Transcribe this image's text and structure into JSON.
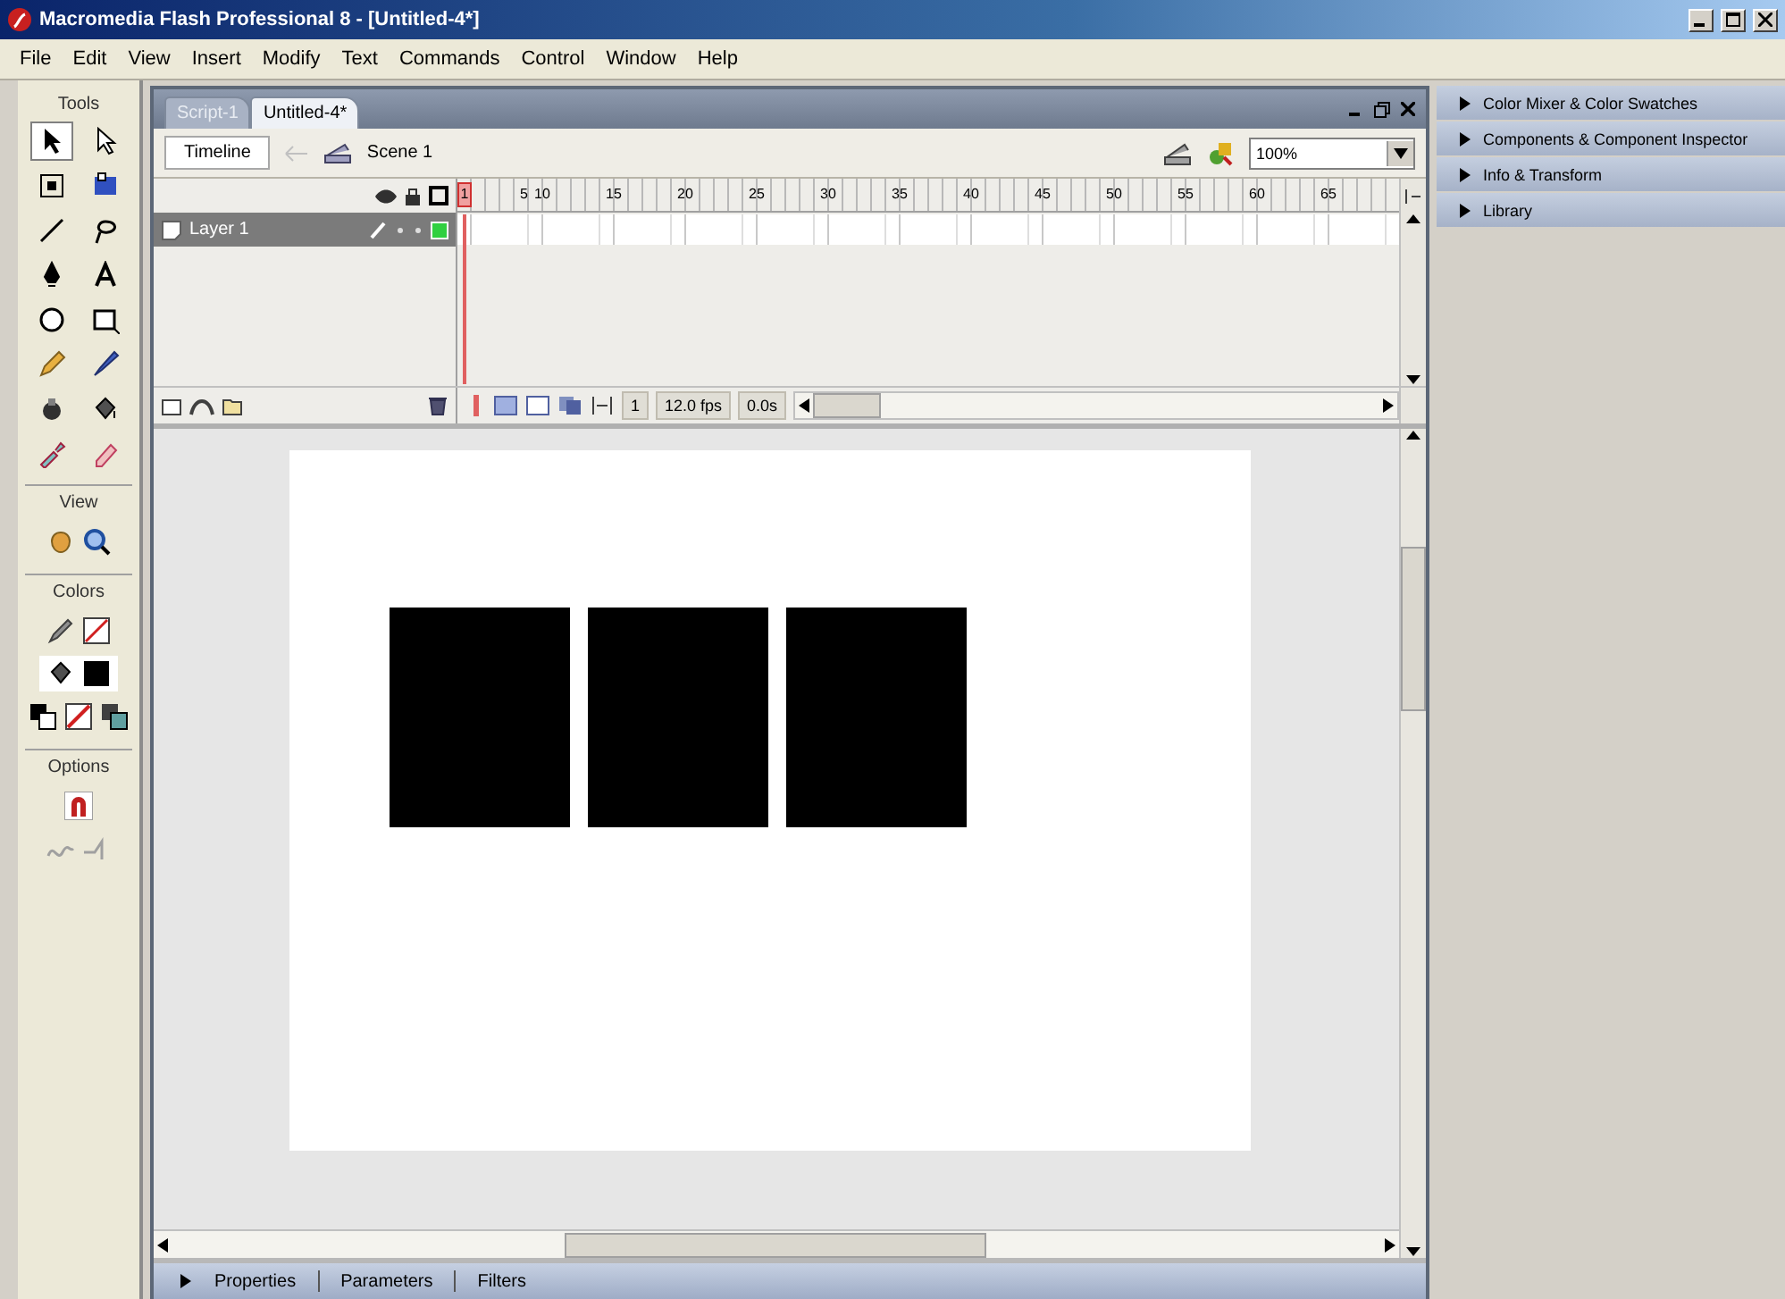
{
  "window": {
    "title": "Macromedia Flash Professional 8 - [Untitled-4*]"
  },
  "menu": [
    "File",
    "Edit",
    "View",
    "Insert",
    "Modify",
    "Text",
    "Commands",
    "Control",
    "Window",
    "Help"
  ],
  "tools": {
    "title": "Tools",
    "items": [
      {
        "kind": "arrow",
        "selected": true
      },
      {
        "kind": "subselect",
        "selected": false
      },
      {
        "kind": "transform",
        "selected": false
      },
      {
        "kind": "gradient",
        "selected": false
      },
      {
        "kind": "line",
        "selected": false
      },
      {
        "kind": "lasso",
        "selected": false
      },
      {
        "kind": "pen",
        "selected": false
      },
      {
        "kind": "text",
        "selected": false
      },
      {
        "kind": "oval",
        "selected": false
      },
      {
        "kind": "rectangle",
        "selected": false
      },
      {
        "kind": "pencil",
        "selected": false
      },
      {
        "kind": "brush",
        "selected": false
      },
      {
        "kind": "ink",
        "selected": false
      },
      {
        "kind": "bucket",
        "selected": false
      },
      {
        "kind": "dropper",
        "selected": false
      },
      {
        "kind": "eraser",
        "selected": false
      }
    ],
    "sections": [
      {
        "title": "View",
        "rows": [
          [
            {
              "kind": "hand"
            },
            {
              "kind": "zoom"
            }
          ]
        ]
      },
      {
        "title": "Colors",
        "rows": [
          [
            {
              "kind": "stroke"
            },
            {
              "kind": "stroke-swatch"
            }
          ],
          [
            {
              "kind": "fill"
            },
            {
              "kind": "fill-swatch"
            }
          ],
          [
            {
              "kind": "default"
            },
            {
              "kind": "none"
            },
            {
              "kind": "swap"
            }
          ]
        ]
      },
      {
        "title": "Options",
        "rows": [
          [
            {
              "kind": "magnet"
            }
          ],
          [
            {
              "kind": "smooth"
            },
            {
              "kind": "straighten"
            }
          ]
        ]
      }
    ]
  },
  "document": {
    "tabs": [
      {
        "label": "Script-1",
        "selected": false
      },
      {
        "label": "Untitled-4*",
        "selected": true
      }
    ],
    "timeline_button": "Timeline",
    "scene": "Scene 1",
    "zoom": "100%",
    "frame_numbers": [
      "1",
      "5",
      "10",
      "15",
      "20",
      "25",
      "30",
      "35",
      "40",
      "45",
      "50",
      "55",
      "60",
      "65"
    ],
    "layers": [
      {
        "name": "Layer 1",
        "selected": true
      }
    ],
    "current_frame": "1",
    "frame_rate": "12.0 fps",
    "elapsed": "0.0s",
    "shapes": [
      {
        "kind": "rectangle"
      },
      {
        "kind": "rectangle"
      },
      {
        "kind": "rectangle"
      }
    ]
  },
  "properties_bar": {
    "expanded": false,
    "tabs": [
      "Properties",
      "Parameters",
      "Filters"
    ]
  },
  "panels": [
    {
      "label": "Color Mixer & Color Swatches",
      "expanded": false
    },
    {
      "label": "Components & Component Inspector",
      "expanded": false
    },
    {
      "label": "Info & Transform",
      "expanded": false
    },
    {
      "label": "Library",
      "expanded": false
    }
  ]
}
